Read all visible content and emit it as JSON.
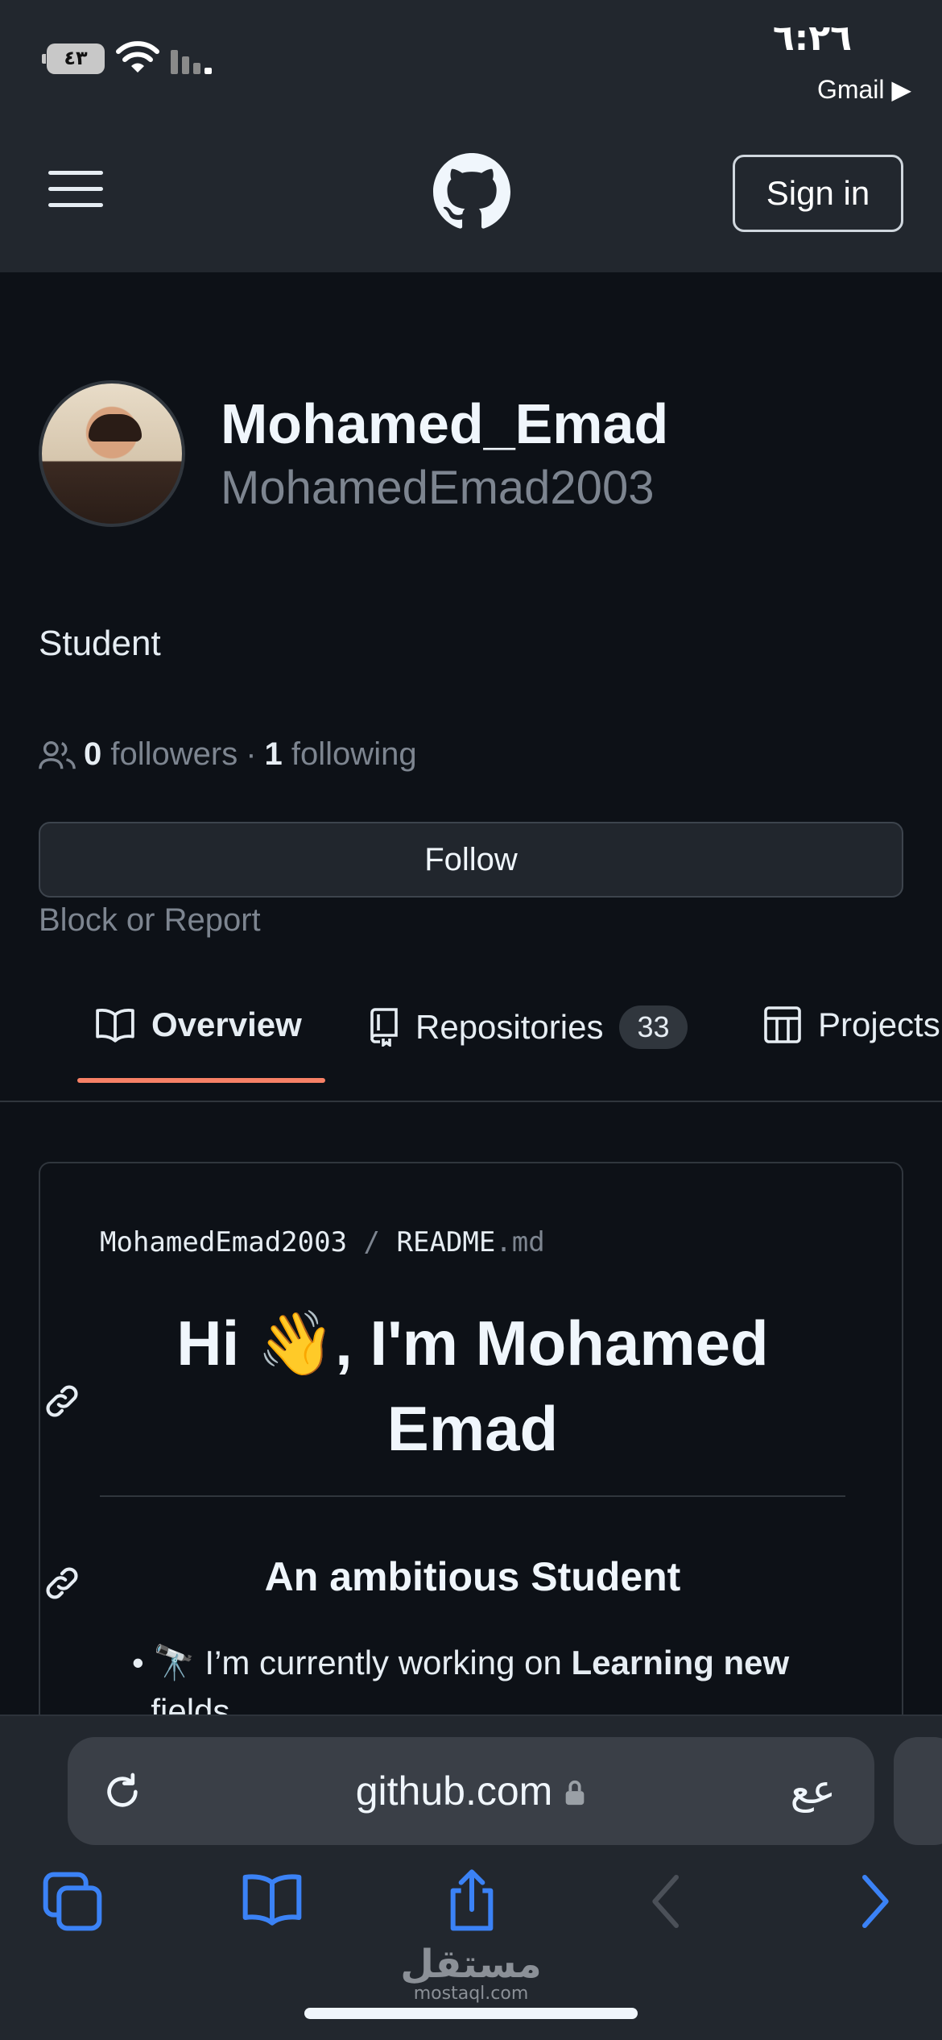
{
  "status_bar": {
    "time": "٦:٢٦",
    "back_app": "Gmail ▶",
    "battery": "٤٣"
  },
  "header": {
    "sign_in_label": "Sign in"
  },
  "profile": {
    "display_name": "Mohamed_Emad",
    "login": "MohamedEmad2003",
    "bio": "Student",
    "followers_count": "0",
    "followers_label": "followers",
    "separator": "·",
    "following_count": "1",
    "following_label": "following",
    "follow_label": "Follow",
    "block_label": "Block or Report"
  },
  "tabs": [
    {
      "label": "Overview",
      "active": true
    },
    {
      "label": "Repositories",
      "count": "33"
    },
    {
      "label": "Projects"
    }
  ],
  "readme": {
    "owner": "MohamedEmad2003",
    "slash": "/",
    "file": "README",
    "ext": ".md",
    "heading_line1": "Hi 👋, I'm Mohamed",
    "heading_line2": "Emad",
    "subheading": "An ambitious Student",
    "bullet_prefix": "🔭 I’m currently working on ",
    "bullet_bold": "Learning new",
    "bullet_cont": "fields"
  },
  "browser": {
    "url": "github.com",
    "text_size_label": "عع"
  },
  "watermark": {
    "brand": "مستقل",
    "domain": "mostaql.com"
  },
  "colors": {
    "background": "#0d1117",
    "header": "#22272e",
    "tab_underline": "#f78166",
    "toolbar_icon": "#3b82f6"
  }
}
